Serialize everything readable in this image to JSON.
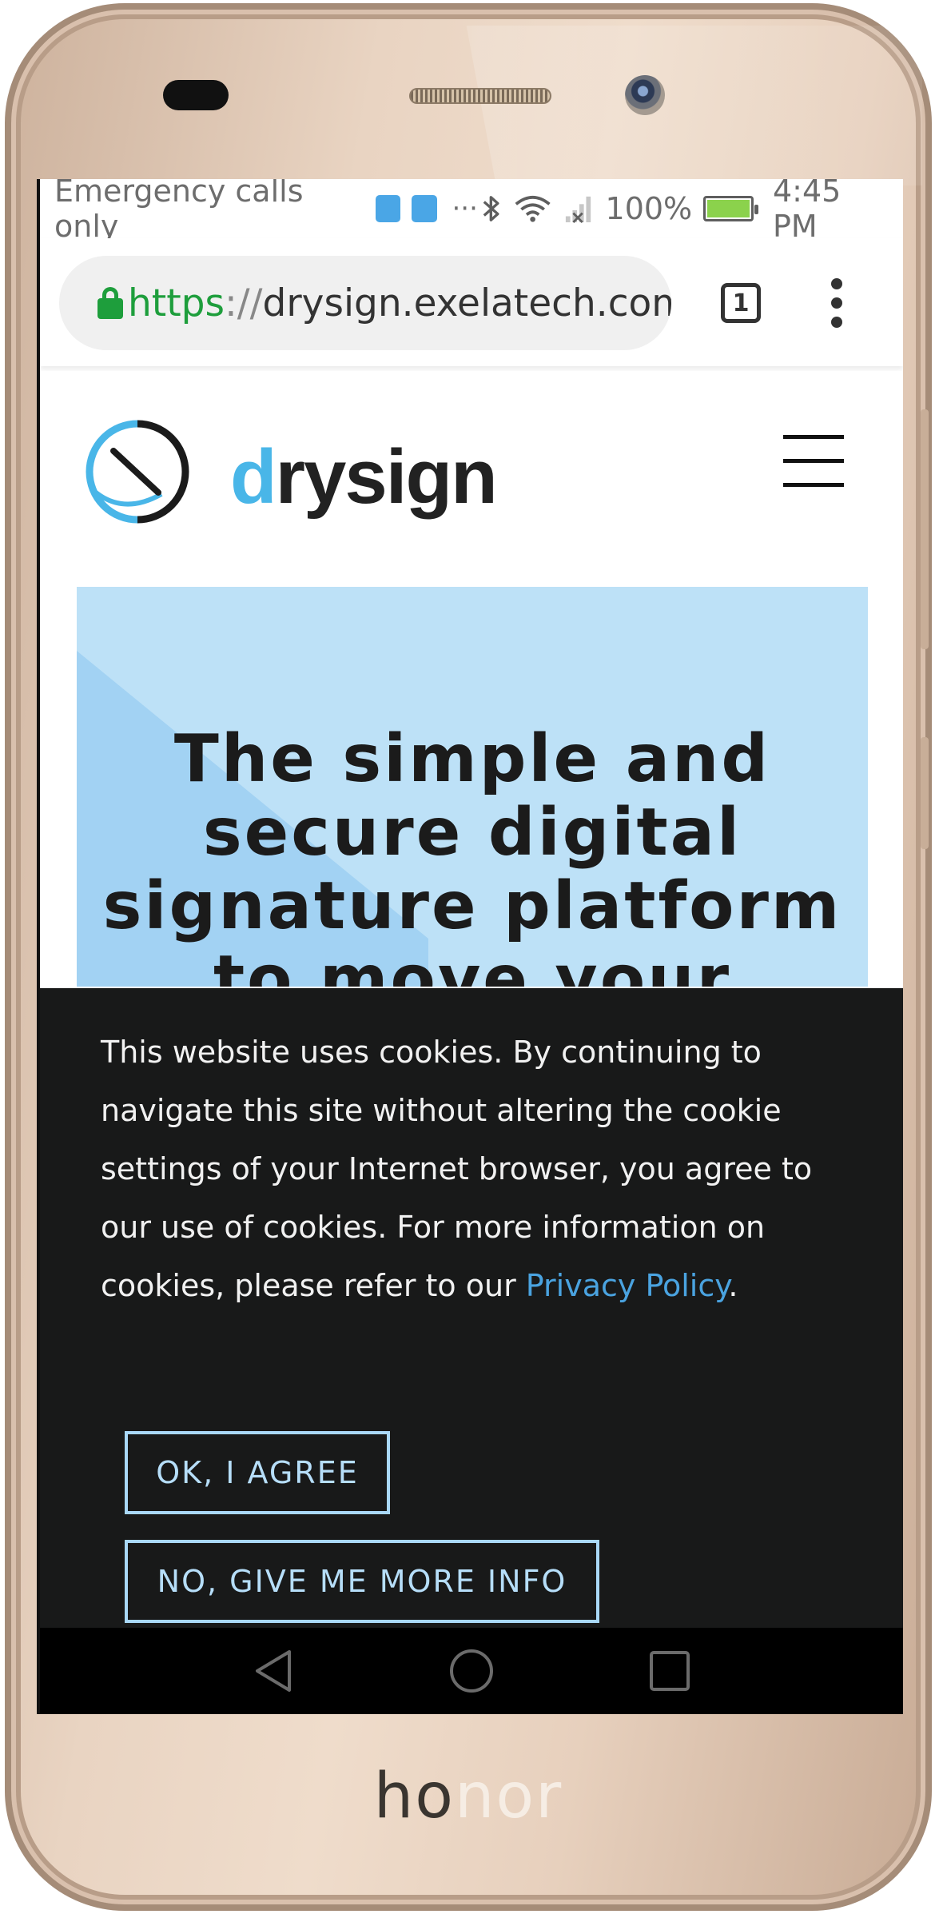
{
  "device": {
    "brand_dark": "ho",
    "brand_light": "nor"
  },
  "status_bar": {
    "carrier": "Emergency calls only",
    "dots": "···",
    "battery_percent": "100%",
    "battery_level": 100,
    "time": "4:45 PM",
    "battery_color": "#8bd24c"
  },
  "browser": {
    "url_scheme": "https",
    "url_sep": "://",
    "url_host": "drysign.exelatech.com",
    "tab_count": "1",
    "secure_color": "#1e9e3c"
  },
  "site": {
    "logo_d": "d",
    "logo_rest": "rysign",
    "brand_color": "#49b6e8"
  },
  "hero": {
    "title_line1": "The simple and",
    "title_line2": "secure digital",
    "title_line3": "signature platform",
    "title_line4": "to move your",
    "background": "#bde1f7"
  },
  "cookie_banner": {
    "message": "This website uses cookies. By continuing to navigate this site without altering the cookie settings of your Internet browser, you agree to our use of cookies. For more information on cookies, please refer to our ",
    "link_text": "Privacy Policy",
    "message_end": ".",
    "agree_label": "OK, I AGREE",
    "more_info_label": "NO, GIVE ME MORE INFO",
    "background": "#181919",
    "link_color": "#4aa3e0"
  },
  "nav_bar": {
    "back": "back-icon",
    "home": "home-icon",
    "recents": "recents-icon"
  }
}
